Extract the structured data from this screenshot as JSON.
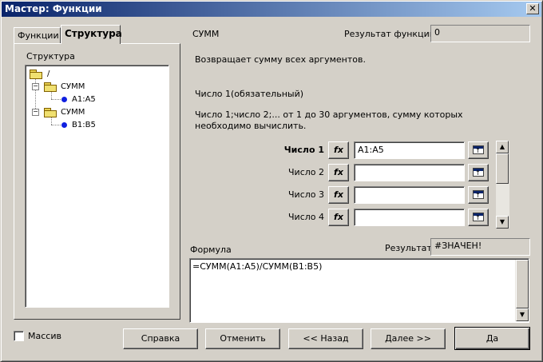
{
  "window": {
    "title": "Мастер: Функции",
    "close_glyph": "✕"
  },
  "tabs": [
    {
      "label": "Функции"
    },
    {
      "label": "Структура"
    }
  ],
  "structure": {
    "label": "Структура",
    "root": "/",
    "nodes": [
      {
        "label": "СУММ",
        "child": "A1:A5"
      },
      {
        "label": "СУММ",
        "child": "B1:B5"
      }
    ]
  },
  "function": {
    "name": "СУММ",
    "result_label": "Результат функции",
    "result_value": "0",
    "description": "Возвращает сумму всех аргументов.",
    "arg_title": "Число 1(обязательный)",
    "arg_description": "Число 1;число 2;... от 1 до 30 аргументов, сумму которых необходимо вычислить."
  },
  "args": [
    {
      "label": "Число 1",
      "value": "A1:A5"
    },
    {
      "label": "Число 2",
      "value": ""
    },
    {
      "label": "Число 3",
      "value": ""
    },
    {
      "label": "Число 4",
      "value": ""
    }
  ],
  "fx_label": "fx",
  "formula": {
    "label": "Формула",
    "result_label": "Результат",
    "result_value": "#ЗНАЧЕН!",
    "text": "=СУММ(A1:A5)/СУММ(B1:B5)"
  },
  "array_checkbox": {
    "label": "Массив",
    "checked": false
  },
  "buttons": {
    "help": "Справка",
    "cancel": "Отменить",
    "back": "<< Назад",
    "next": "Далее >>",
    "ok": "Да"
  },
  "scroll_up_glyph": "▲",
  "scroll_down_glyph": "▼"
}
